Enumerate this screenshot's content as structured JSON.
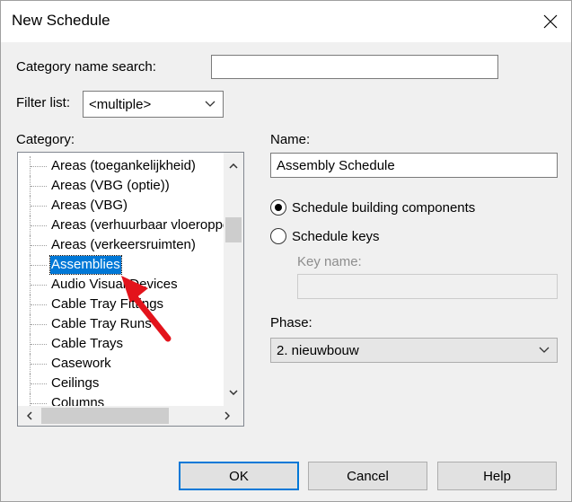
{
  "window": {
    "title": "New Schedule"
  },
  "category_search": {
    "label": "Category name search:",
    "value": ""
  },
  "filter_list": {
    "label": "Filter list:",
    "value": "<multiple>"
  },
  "category": {
    "label": "Category:",
    "items": [
      "Areas (toegankelijkheid)",
      "Areas (VBG (optie))",
      "Areas (VBG)",
      "Areas (verhuurbaar vloeroppe",
      "Areas (verkeersruimten)",
      "Assemblies",
      "Audio Visual Devices",
      "Cable Tray Fittings",
      "Cable Tray Runs",
      "Cable Trays",
      "Casework",
      "Ceilings",
      "Columns"
    ],
    "selected": "Assemblies"
  },
  "name": {
    "label": "Name:",
    "value": "Assembly Schedule"
  },
  "options": {
    "building_components": "Schedule building components",
    "schedule_keys": "Schedule keys",
    "selected": "building_components"
  },
  "key_name": {
    "label": "Key name:",
    "value": ""
  },
  "phase": {
    "label": "Phase:",
    "value": "2. nieuwbouw"
  },
  "buttons": {
    "ok": "OK",
    "cancel": "Cancel",
    "help": "Help"
  },
  "colors": {
    "selection": "#0078d7",
    "annotation_arrow": "#e3131b"
  },
  "icons": {
    "close": "close-icon",
    "dropdown": "chevron-down-icon",
    "annotation": "red-arrow-annotation"
  }
}
